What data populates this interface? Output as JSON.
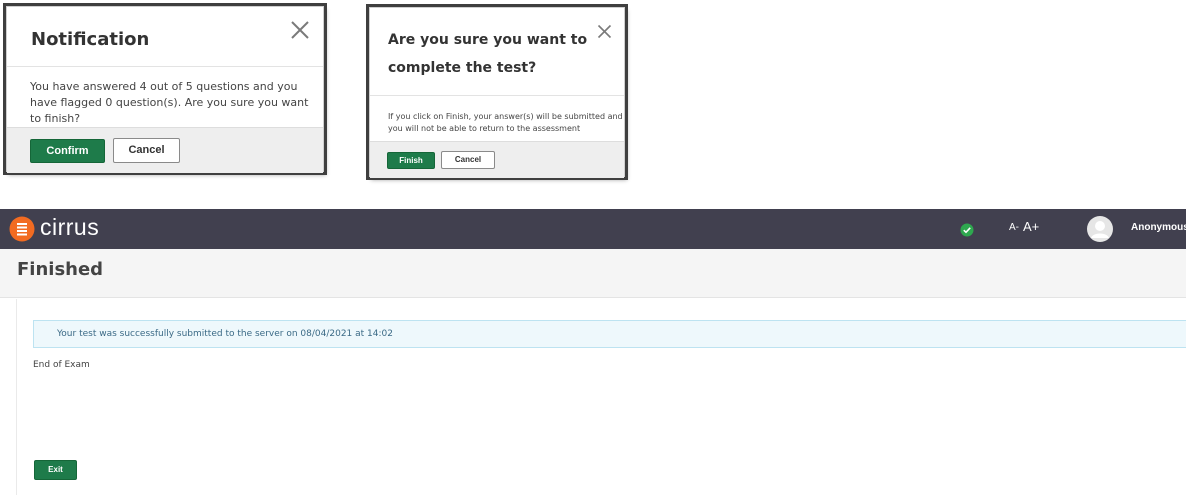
{
  "dialog_notification": {
    "title": "Notification",
    "message": "You have answered 4 out of 5 questions and you have flagged 0 question(s). Are you sure you want to finish?",
    "confirm_label": "Confirm",
    "cancel_label": "Cancel",
    "close_icon": "close-icon"
  },
  "dialog_complete": {
    "title": "Are you sure you want to complete the test?",
    "message": "If you click on Finish, your answer(s) will be submitted and you will not be able to return to the assessment",
    "finish_label": "Finish",
    "cancel_label": "Cancel",
    "close_icon": "close-icon"
  },
  "app": {
    "brand": "cirrus",
    "logo_icon": "cirrus-logo-icon",
    "status_icon": "check-circle-icon",
    "font_decrease": "A-",
    "font_increase": "A+",
    "avatar_icon": "user-avatar-icon",
    "username": "Anonymous"
  },
  "page": {
    "title": "Finished",
    "alert": "Your test was successfully submitted to the server on 08/04/2021 at 14:02",
    "end_text": "End of Exam",
    "exit_label": "Exit"
  },
  "colors": {
    "topbar": "#41404f",
    "brand_orange": "#f26b21",
    "primary_green": "#1e7b4a",
    "status_green": "#2ea84f",
    "alert_bg": "#eef8fc",
    "alert_border": "#bde3f1"
  }
}
